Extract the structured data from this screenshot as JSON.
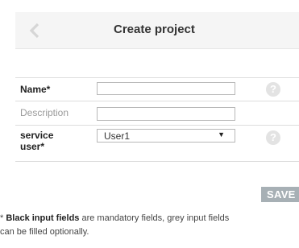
{
  "header": {
    "title": "Create project",
    "back_icon": "chevron-left-icon"
  },
  "form": {
    "name": {
      "label": "Name*",
      "value": "",
      "help_icon": "question-circle-icon",
      "help_glyph": "?"
    },
    "description": {
      "label": "Description",
      "value": ""
    },
    "service_user": {
      "label_line1": "service",
      "label_line2": "user*",
      "selected": "User1",
      "arrow": "▼",
      "help_icon": "question-circle-icon",
      "help_glyph": "?"
    }
  },
  "actions": {
    "save_label": "SAVE"
  },
  "footnote": {
    "prefix": "* ",
    "bold": "Black input fields",
    "rest_line1": " are mandatory fields, grey input fields",
    "line2": "can be filled optionally."
  },
  "colors": {
    "header_bg": "#f5f5f5",
    "save_bg": "#a7b0b5",
    "help_icon_bg": "#e3e3e3",
    "optional_label": "#9a9a9a"
  }
}
